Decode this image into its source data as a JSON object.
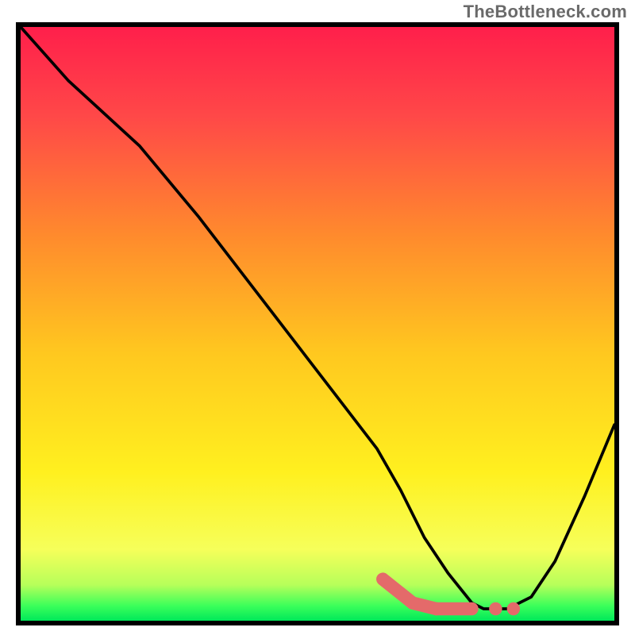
{
  "watermark": "TheBottleneck.com",
  "chart_data": {
    "type": "line",
    "title": "",
    "xlabel": "",
    "ylabel": "",
    "xlim": [
      0,
      100
    ],
    "ylim": [
      0,
      100
    ],
    "series": [
      {
        "name": "curve",
        "x": [
          0,
          8,
          20,
          30,
          40,
          50,
          60,
          64,
          68,
          72,
          76,
          78,
          82,
          86,
          90,
          95,
          100
        ],
        "y": [
          100,
          91,
          80,
          68,
          55,
          42,
          29,
          22,
          14,
          8,
          3,
          2,
          2,
          4,
          10,
          21,
          33
        ]
      },
      {
        "name": "highlight-segments",
        "style": "thick-dots",
        "x": [
          61,
          66,
          70,
          73,
          76,
          80,
          83
        ],
        "y": [
          7,
          3,
          2,
          2,
          2,
          2,
          2
        ]
      }
    ],
    "gradient_stops": [
      {
        "offset": 0.0,
        "color": "#ff1f4b"
      },
      {
        "offset": 0.15,
        "color": "#ff4848"
      },
      {
        "offset": 0.35,
        "color": "#ff8a2d"
      },
      {
        "offset": 0.55,
        "color": "#ffc81f"
      },
      {
        "offset": 0.75,
        "color": "#fff01f"
      },
      {
        "offset": 0.88,
        "color": "#f6ff5a"
      },
      {
        "offset": 0.94,
        "color": "#b6ff5a"
      },
      {
        "offset": 0.975,
        "color": "#3bff5a"
      },
      {
        "offset": 1.0,
        "color": "#00e85a"
      }
    ]
  }
}
